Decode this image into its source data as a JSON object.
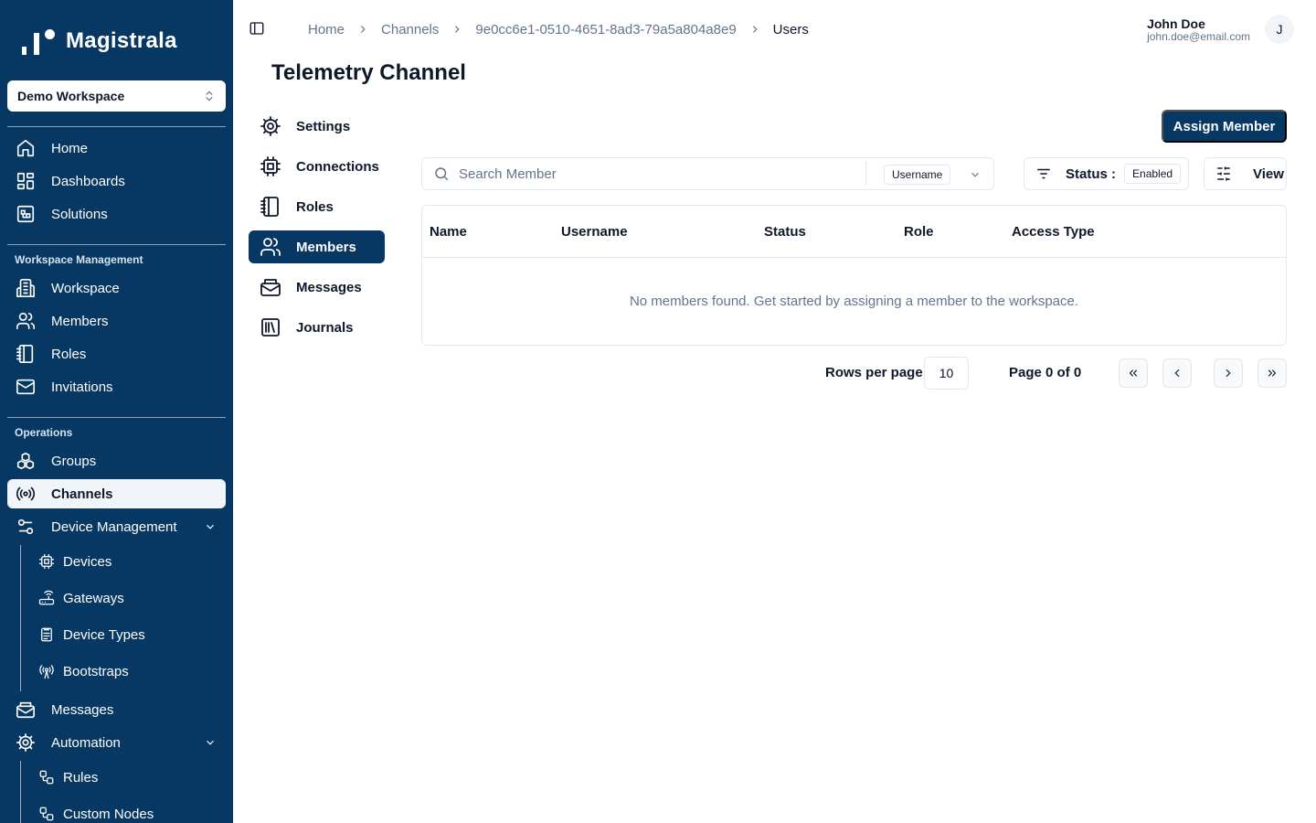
{
  "brand": {
    "name": "Magistrala"
  },
  "workspace_select": {
    "value": "Demo Workspace"
  },
  "sidebar": {
    "top_items": [
      {
        "label": "Home",
        "icon": "home-icon"
      },
      {
        "label": "Dashboards",
        "icon": "dashboard-icon"
      },
      {
        "label": "Solutions",
        "icon": "solutions-icon"
      }
    ],
    "workspace_section": "Workspace Management",
    "workspace_items": [
      {
        "label": "Workspace",
        "icon": "building-icon"
      },
      {
        "label": "Members",
        "icon": "users-icon"
      },
      {
        "label": "Roles",
        "icon": "notebook-icon"
      },
      {
        "label": "Invitations",
        "icon": "mail-icon"
      }
    ],
    "operations_section": "Operations",
    "operations_items": [
      {
        "label": "Groups",
        "icon": "boxes-icon"
      },
      {
        "label": "Channels",
        "icon": "radio-icon",
        "active": true
      },
      {
        "label": "Device Management",
        "icon": "settings-sliders-icon",
        "expanded": true
      }
    ],
    "device_items": [
      {
        "label": "Devices",
        "icon": "cpu-icon"
      },
      {
        "label": "Gateways",
        "icon": "router-icon"
      },
      {
        "label": "Device Types",
        "icon": "clipboard-icon"
      },
      {
        "label": "Bootstraps",
        "icon": "antenna-icon"
      }
    ],
    "bottom_items": [
      {
        "label": "Messages",
        "icon": "mail-open-icon"
      },
      {
        "label": "Automation",
        "icon": "gear-icon",
        "expanded": true
      }
    ],
    "automation_items": [
      {
        "label": "Rules",
        "icon": "workflow-icon"
      },
      {
        "label": "Custom Nodes",
        "icon": "workflow-icon"
      }
    ]
  },
  "breadcrumb": [
    "Home",
    "Channels",
    "9e0cc6e1-0510-4651-8ad3-79a5a804a8e9",
    "Users"
  ],
  "user": {
    "name": "John Doe",
    "email": "john.doe@email.com",
    "initial": "J"
  },
  "page": {
    "title": "Telemetry Channel"
  },
  "channel_nav": [
    {
      "label": "Settings",
      "icon": "gear-icon"
    },
    {
      "label": "Connections",
      "icon": "cpu-icon"
    },
    {
      "label": "Roles",
      "icon": "notebook-icon"
    },
    {
      "label": "Members",
      "icon": "users-icon",
      "active": true
    },
    {
      "label": "Messages",
      "icon": "mail-open-icon"
    },
    {
      "label": "Journals",
      "icon": "library-icon"
    }
  ],
  "actions": {
    "assign_member": "Assign Member",
    "view": "View"
  },
  "search": {
    "placeholder": "Search Member",
    "value": "",
    "field": "Username"
  },
  "status_filter": {
    "label": "Status :",
    "value": "Enabled"
  },
  "table": {
    "columns": [
      "Name",
      "Username",
      "Status",
      "Role",
      "Access Type"
    ],
    "rows": [],
    "empty_message": "No members found. Get started by assigning a member to the workspace."
  },
  "pagination": {
    "rows_label": "Rows per page",
    "rows_per_page": "10",
    "page_info": "Page 0 of 0"
  },
  "colors": {
    "primary": "#073763",
    "border": "#e2e8f0",
    "muted": "#64748b"
  }
}
